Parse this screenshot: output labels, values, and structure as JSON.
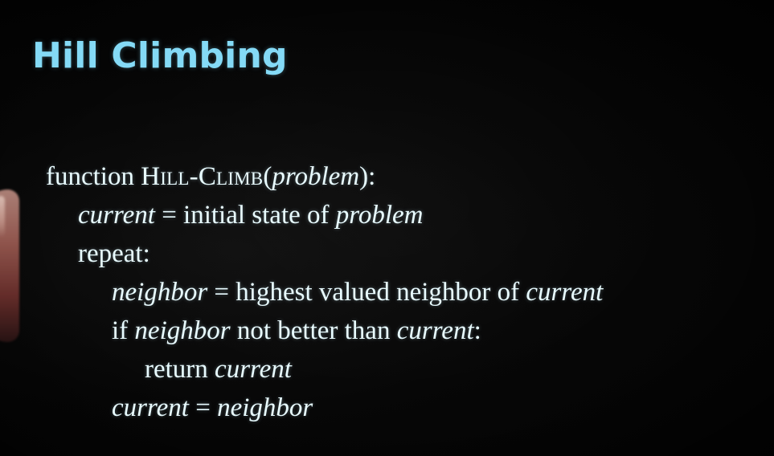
{
  "slide": {
    "title": "Hill Climbing",
    "pseudocode": [
      {
        "id": "line-1",
        "indent": 0,
        "parts": [
          {
            "text": "function ",
            "style": "normal"
          },
          {
            "text": "Hill-Climb",
            "style": "smallcaps"
          },
          {
            "text": "(",
            "style": "normal"
          },
          {
            "text": "problem",
            "style": "italic"
          },
          {
            "text": "):",
            "style": "normal"
          }
        ]
      },
      {
        "id": "line-2",
        "indent": 1,
        "parts": [
          {
            "text": "current",
            "style": "italic"
          },
          {
            "text": " = initial state of ",
            "style": "normal"
          },
          {
            "text": "problem",
            "style": "italic"
          }
        ]
      },
      {
        "id": "line-3",
        "indent": 1,
        "parts": [
          {
            "text": "repeat:",
            "style": "normal"
          }
        ]
      },
      {
        "id": "line-4",
        "indent": 2,
        "parts": [
          {
            "text": "neighbor",
            "style": "italic"
          },
          {
            "text": " = highest valued neighbor of ",
            "style": "normal"
          },
          {
            "text": "current",
            "style": "italic"
          }
        ]
      },
      {
        "id": "line-5",
        "indent": 2,
        "parts": [
          {
            "text": "if ",
            "style": "normal"
          },
          {
            "text": "neighbor",
            "style": "italic"
          },
          {
            "text": " not better than ",
            "style": "normal"
          },
          {
            "text": "current",
            "style": "italic"
          },
          {
            "text": ":",
            "style": "normal"
          }
        ]
      },
      {
        "id": "line-6",
        "indent": 3,
        "parts": [
          {
            "text": "return ",
            "style": "normal"
          },
          {
            "text": "current",
            "style": "italic"
          }
        ]
      },
      {
        "id": "line-7",
        "indent": 2,
        "parts": [
          {
            "text": "current",
            "style": "italic"
          },
          {
            "text": " = ",
            "style": "normal"
          },
          {
            "text": "neighbor",
            "style": "italic"
          }
        ]
      }
    ]
  },
  "colors": {
    "background": "#000000",
    "title": "#84daf6",
    "code": "#e8fbff"
  }
}
